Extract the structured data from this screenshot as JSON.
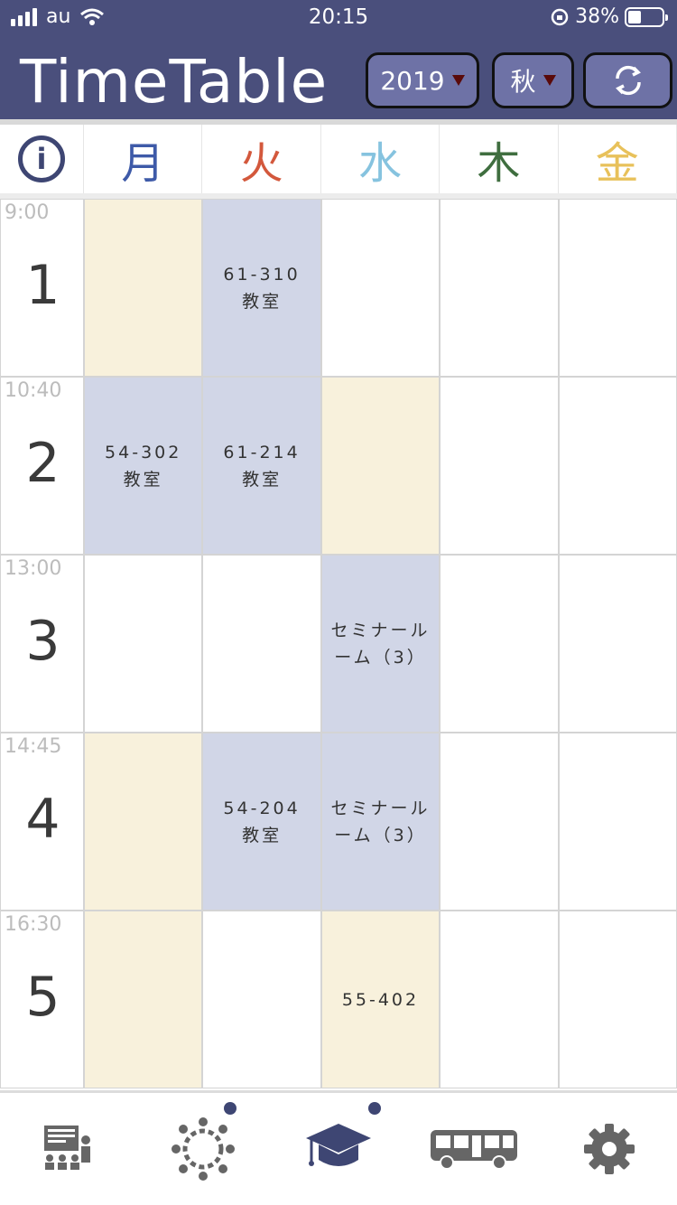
{
  "status": {
    "carrier": "au",
    "time": "20:15",
    "battery": "38%"
  },
  "header": {
    "title": "TimeTable",
    "year": "2019",
    "term": "秋"
  },
  "days": [
    "月",
    "火",
    "水",
    "木",
    "金"
  ],
  "day_colors": [
    "#3e5aa8",
    "#d3583c",
    "#86c3df",
    "#3f6e3f",
    "#e8c15a"
  ],
  "periods": [
    {
      "time": "9:00",
      "num": "1"
    },
    {
      "time": "10:40",
      "num": "2"
    },
    {
      "time": "13:00",
      "num": "3"
    },
    {
      "time": "14:45",
      "num": "4"
    },
    {
      "time": "16:30",
      "num": "5"
    }
  ],
  "cells": [
    [
      "",
      "61-310\n教室",
      "",
      "",
      ""
    ],
    [
      "54-302\n教室",
      "61-214\n教室",
      "",
      "",
      ""
    ],
    [
      "",
      "",
      "セミナール\nーム（3）",
      "",
      ""
    ],
    [
      "",
      "54-204\n教室",
      "セミナール\nーム（3）",
      "",
      ""
    ],
    [
      "",
      "",
      "55-402",
      "",
      ""
    ]
  ],
  "cell_colors": [
    [
      "cream",
      "blue",
      "white",
      "white",
      "white"
    ],
    [
      "blue",
      "blue",
      "cream",
      "white",
      "white"
    ],
    [
      "white",
      "white",
      "blue",
      "white",
      "white"
    ],
    [
      "cream",
      "blue",
      "blue",
      "white",
      "white"
    ],
    [
      "cream",
      "white",
      "cream",
      "white",
      "white"
    ]
  ],
  "tabs": [
    {
      "icon": "lecture-icon",
      "dot": false
    },
    {
      "icon": "community-icon",
      "dot": true
    },
    {
      "icon": "graduation-cap-icon",
      "dot": true
    },
    {
      "icon": "bus-icon",
      "dot": false
    },
    {
      "icon": "gear-icon",
      "dot": false
    }
  ]
}
